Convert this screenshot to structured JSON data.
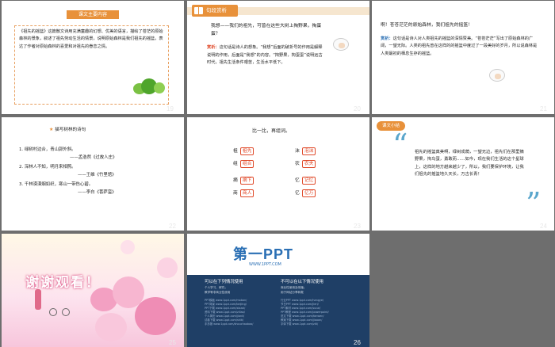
{
  "slides": [
    {
      "number": "19",
      "banner": "课文主要内容",
      "text": "《祖先的摇篮》这篇散文诗用充满童趣的幻想、优美的语言，描绘了苍茫的原始森林的景象，叙述了祖先劳动生活的情景，说明原始森林是我们祖先的摇篮，表达了作者对原始森林的喜爱和对祖先的眷恋之情。"
    },
    {
      "number": "20",
      "header": "句段赏析",
      "quote": "我想——我们的祖先，可曾在这些大树上掏野果，掏蛋蛋？",
      "note_label": "赏析：",
      "note": "这句话是诗人的想象。“我想”后面的破折号的作用是解释说明的作用，后面是“我想”的内容。“掏野果，掏蛋蛋”说明远古时代，祖先生活条件艰苦，生活水平低下。"
    },
    {
      "number": "21",
      "header": "句段赏析",
      "quote": "啊！苍苍茫茫的原始森林，我们祖先的摇篮！",
      "note_label": "赏析：",
      "note": "这句话是诗人对人类祖先的摇篮的深情赞美。“苍苍茫茫”写出了原始森林的广阔，一望无际。人类的祖先曾在这样的的摇篮中度过了一段美好的岁月，所以说森林是人类最初的栖息生存的摇篮。"
    },
    {
      "number": "22",
      "title": "描写树林的诗句",
      "lines": [
        "1. 绿树村边合，青山郭外斜。",
        "——孟浩然《过故人庄》",
        "2. 深林人不知，明月来相照。",
        "——王维《竹里馆》",
        "3. 千林漠漠烟如织，寒山一带伤心碧。",
        "——李白《菩萨蛮》"
      ]
    },
    {
      "number": "23",
      "title": "比一比，再组词。",
      "pairs": [
        {
          "a": "祖",
          "aw": "祖先",
          "b": "沫",
          "bw": "泡沫"
        },
        {
          "a": "组",
          "aw": "组合",
          "b": "农",
          "bw": "农夫"
        },
        {
          "a": "摘",
          "aw": "摘下",
          "b": "忆",
          "bw": "记忆"
        },
        {
          "a": "商",
          "aw": "商人",
          "b": "亿",
          "bw": "亿万"
        }
      ]
    },
    {
      "number": "24",
      "tag": "课文小结",
      "text": "祖先的摇篮真美啊，绿树成荫，一望无边，祖先们在那里摘野果，掏鸟蛋，勇敢而……如今，现在我们生活的这个星球上，这样的地方越来越少了，所以，我们要保护环境，让我们祖先的摇篮地久天长，万古长青！"
    },
    {
      "number": "25",
      "thanks": "谢谢观看！"
    },
    {
      "number": "26",
      "logo": "第一PPT",
      "url": "WWW.1PPT.COM",
      "col1_title": "可以在下列情况使用",
      "col2_title": "不可以在以下情况使用",
      "col1_text": "个人学习、研究；\n教学等非商业性使用",
      "col2_text": "商业性使用及传播；\n用于网站分享转载",
      "links1": [
        "PPT模板 www.1ppt.com/moban/",
        "PPT背景 www.1ppt.com/beijing/",
        "PPT下载 www.1ppt.com/xiazai/",
        "资料下载 www.1ppt.com/ziliao/",
        "个人简历 www.1ppt.com/jianli/",
        "试卷下载 www.1ppt.com/shiti/",
        "手抄报 www.1ppt.com/shouchaobao/"
      ],
      "links2": [
        "行业PPT www.1ppt.com/hangye/",
        "节日PPT www.1ppt.com/jieri/",
        "PPT素材 www.1ppt.com/sucai/",
        "PPT教程 www.1ppt.com/powerpoint/",
        "范文下载 www.1ppt.com/fanwen/",
        "教案下载 www.1ppt.com/jiaoan/",
        "字体下载 www.1ppt.com/ziti/"
      ]
    }
  ]
}
